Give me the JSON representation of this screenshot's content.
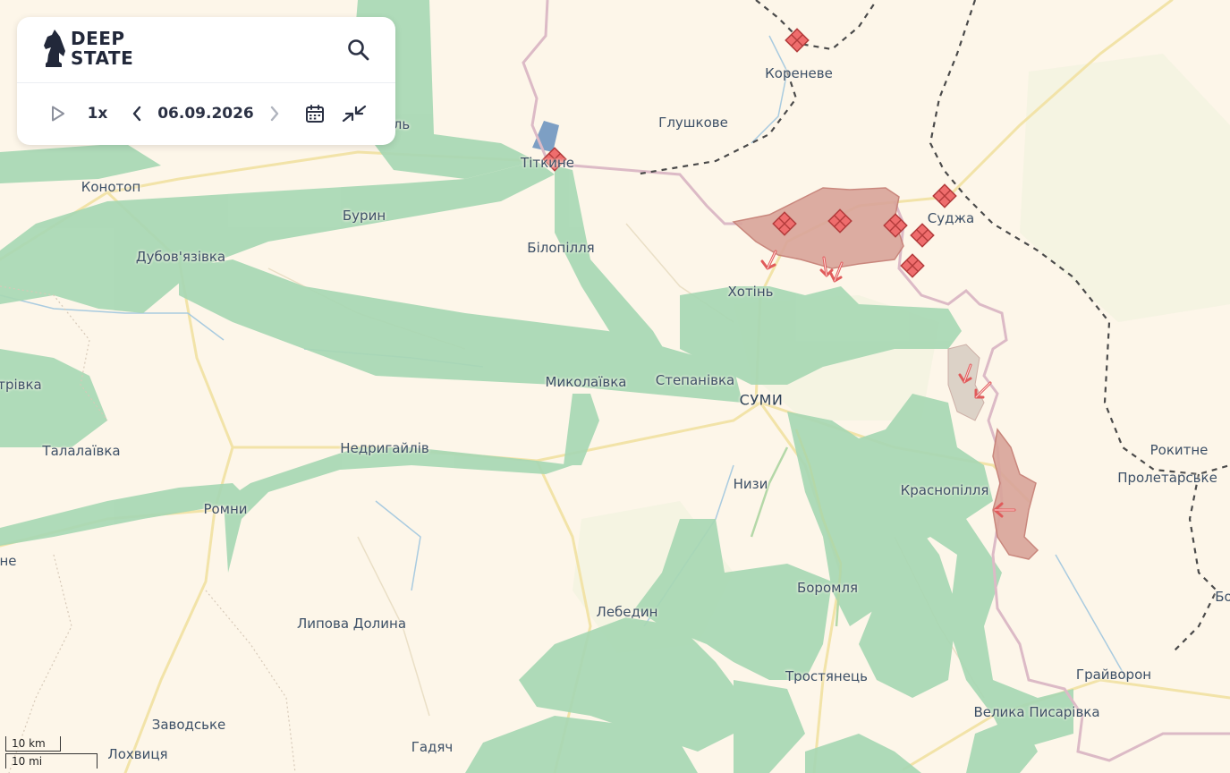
{
  "app": {
    "logo_line1": "DEEP",
    "logo_line2": "STATE"
  },
  "timeline": {
    "speed": "1x",
    "date": "06.09.2026"
  },
  "icons": {
    "play": "play-icon",
    "prev": "chevron-left-icon",
    "next": "chevron-right-icon",
    "calendar": "calendar-icon",
    "collapse": "collapse-arrows-icon",
    "search": "search-icon"
  },
  "colors": {
    "liberated": "#a8d8b4",
    "occupied": "#d9a49a",
    "occupied_edge": "#c47c72",
    "marker": "#ef6d6d",
    "border_pink": "#d9b8c4",
    "land": "#fdf6e9",
    "road": "#f2e3a8"
  },
  "scale": {
    "km": "10 km",
    "mi": "10 mi"
  },
  "cities": [
    {
      "name": "Кореневе"
    },
    {
      "name": "Глушкове"
    },
    {
      "name": "Тіткине"
    },
    {
      "name": "Суджа"
    },
    {
      "name": "Конотоп"
    },
    {
      "name": "Бурин"
    },
    {
      "name": "Білопілля"
    },
    {
      "name": "Дубов'язівка"
    },
    {
      "name": "Хотінь"
    },
    {
      "name": "Миколаївка"
    },
    {
      "name": "Степанівка"
    },
    {
      "name": "СУМИ"
    },
    {
      "name": "Недригайлів"
    },
    {
      "name": "Талалаївка"
    },
    {
      "name": "Ромни"
    },
    {
      "name": "Низи"
    },
    {
      "name": "Краснопілля"
    },
    {
      "name": "Рокитне"
    },
    {
      "name": "Пролетарське"
    },
    {
      "name": "Боромля"
    },
    {
      "name": "Лебедин"
    },
    {
      "name": "Липова Долина"
    },
    {
      "name": "Тростянець"
    },
    {
      "name": "Грайворон"
    },
    {
      "name": "Велика Писарівка"
    },
    {
      "name": "Заводське"
    },
    {
      "name": "Гадяч"
    },
    {
      "name": "Лохвиця"
    },
    {
      "name": "трівка"
    },
    {
      "name": "не"
    },
    {
      "name": "Бо"
    },
    {
      "name": "ль"
    }
  ]
}
